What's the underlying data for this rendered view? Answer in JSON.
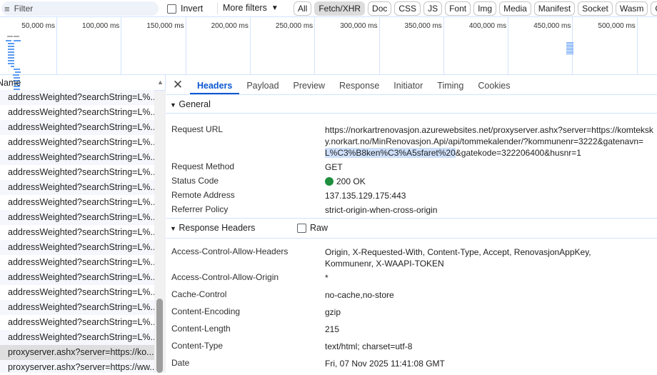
{
  "toolbar": {
    "filter_placeholder": "Filter",
    "invert_label": "Invert",
    "more_filters_label": "More filters",
    "chips": [
      "All",
      "Fetch/XHR",
      "Doc",
      "CSS",
      "JS",
      "Font",
      "Img",
      "Media",
      "Manifest",
      "Socket",
      "Wasm",
      "Other"
    ],
    "active_chip": "Fetch/XHR"
  },
  "timeline": {
    "ticks": [
      "50,000 ms",
      "100,000 ms",
      "150,000 ms",
      "200,000 ms",
      "250,000 ms",
      "300,000 ms",
      "350,000 ms",
      "400,000 ms",
      "450,000 ms",
      "500,000 ms"
    ]
  },
  "list": {
    "header": "Name",
    "rows": [
      "addressWeighted?searchString=L%...",
      "addressWeighted?searchString=L%...",
      "addressWeighted?searchString=L%...",
      "addressWeighted?searchString=L%...",
      "addressWeighted?searchString=L%...",
      "addressWeighted?searchString=L%...",
      "addressWeighted?searchString=L%...",
      "addressWeighted?searchString=L%...",
      "addressWeighted?searchString=L%...",
      "addressWeighted?searchString=L%...",
      "addressWeighted?searchString=L%...",
      "addressWeighted?searchString=L%...",
      "addressWeighted?searchString=L%...",
      "addressWeighted?searchString=L%...",
      "addressWeighted?searchString=L%...",
      "addressWeighted?searchString=L%...",
      "addressWeighted?searchString=L%...",
      "proxyserver.ashx?server=https://ko...",
      "proxyserver.ashx?server=https://ww..."
    ],
    "selected_index": 17
  },
  "details": {
    "tabs": [
      "Headers",
      "Payload",
      "Preview",
      "Response",
      "Initiator",
      "Timing",
      "Cookies"
    ],
    "active_tab": "Headers",
    "general": {
      "title": "General",
      "request_url_label": "Request URL",
      "request_url_part1": "https://norkartrenovasjon.azurewebsites.net/proxyserver.ashx?server=https://komteksky.norkart.no/MinRenovasjon.Api/api/tommekalender/?kommunenr=3222&gatenavn=",
      "request_url_highlight": "L%C3%B8ken%C3%A5sfaret%20",
      "request_url_part2": "&gatekode=322206400&husnr=1",
      "method_label": "Request Method",
      "method": "GET",
      "status_label": "Status Code",
      "status": "200 OK",
      "status_color": "#1e8e3e",
      "remote_label": "Remote Address",
      "remote": "137.135.129.175:443",
      "referrer_label": "Referrer Policy",
      "referrer": "strict-origin-when-cross-origin"
    },
    "response_headers": {
      "title": "Response Headers",
      "raw_label": "Raw",
      "items": [
        {
          "k": "Access-Control-Allow-Headers",
          "v": "Origin, X-Requested-With, Content-Type, Accept, RenovasjonAppKey, Kommunenr, X-WAAPI-TOKEN"
        },
        {
          "k": "Access-Control-Allow-Origin",
          "v": "*"
        },
        {
          "k": "Cache-Control",
          "v": "no-cache,no-store"
        },
        {
          "k": "Content-Encoding",
          "v": "gzip"
        },
        {
          "k": "Content-Length",
          "v": "215"
        },
        {
          "k": "Content-Type",
          "v": "text/html; charset=utf-8"
        },
        {
          "k": "Date",
          "v": "Fri, 07 Nov 2025 11:41:08 GMT"
        }
      ]
    }
  }
}
